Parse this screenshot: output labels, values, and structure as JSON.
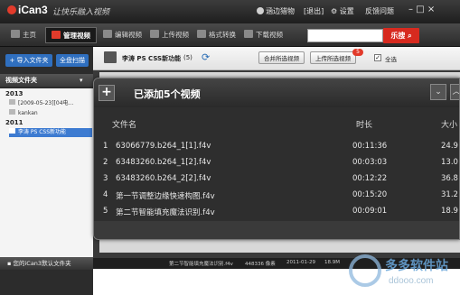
{
  "app": {
    "logo": "iCan3",
    "slogan": "让快乐融入视频"
  },
  "titlebar": {
    "user_label": "涵边猎物",
    "logout_label": "[退出]",
    "settings_label": "设置",
    "feedback_label": "反馈问题"
  },
  "toolbar": {
    "tabs": [
      {
        "label": "主页"
      },
      {
        "label": "管理视频"
      },
      {
        "label": "编辑视频"
      },
      {
        "label": "上传视频"
      },
      {
        "label": "格式转换"
      },
      {
        "label": "下载视频"
      }
    ],
    "search_placeholder": "",
    "search_button": "乐搜"
  },
  "sidebar": {
    "import_button": "+ 导入文件夹",
    "scan_button": "全盘扫描",
    "section_title": "视频文件夹",
    "years": [
      {
        "year": "2013",
        "items": [
          "[2009-05-23][04电...",
          "kankan"
        ]
      },
      {
        "year": "2011",
        "items": [
          "李涛 PS CSS新功能"
        ]
      }
    ],
    "footer": "您的iCan3默认文件夹"
  },
  "folderbar": {
    "folder_name": "李涛 PS CSS新功能",
    "count": "(5)",
    "merge_button": "合并所选视频",
    "upload_button": "上传所选视频",
    "upload_badge": "5",
    "select_all": "全选",
    "select_all_mark": "✓"
  },
  "panel": {
    "plus": "+",
    "title": "已添加5个视频",
    "collapse_icon": "⌄",
    "columns": {
      "name": "文件名",
      "duration": "时长",
      "size": "大小"
    },
    "rows": [
      {
        "index": "1",
        "name": "63066779.b264_1[1].f4v",
        "duration": "00:11:36",
        "size": "24.9"
      },
      {
        "index": "2",
        "name": "63483260.b264_1[2].f4v",
        "duration": "00:03:03",
        "size": "13.0"
      },
      {
        "index": "3",
        "name": "63483260.b264_2[2].f4v",
        "duration": "00:12:22",
        "size": "36.8"
      },
      {
        "index": "4",
        "name": "第一节调整边缘快速构图.f4v",
        "duration": "00:15:20",
        "size": "31.2"
      },
      {
        "index": "5",
        "name": "第二节智能填充魔法识别.f4v",
        "duration": "00:09:01",
        "size": "18.9"
      }
    ]
  },
  "statusbar": {
    "file": "第二节智能填充魔法识别.f4v",
    "res": "448336 像素",
    "date": "2011-01-29",
    "size": "18.9M"
  },
  "watermark": {
    "text": "多多软件站",
    "url": "ddooo.com"
  }
}
